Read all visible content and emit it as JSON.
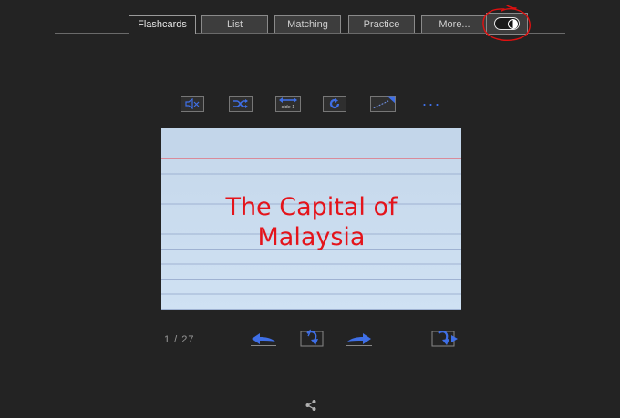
{
  "tabs": [
    {
      "label": "Flashcards",
      "active": true
    },
    {
      "label": "List",
      "active": false
    },
    {
      "label": "Matching",
      "active": false
    },
    {
      "label": "Practice",
      "active": false
    },
    {
      "label": "More...",
      "active": false
    }
  ],
  "theme_toggle": {
    "icon": "contrast-toggle-icon",
    "annotated": true,
    "annotation_color": "#e01010"
  },
  "toolbar": {
    "buttons": [
      {
        "name": "mute-button",
        "icon": "speaker-muted-icon"
      },
      {
        "name": "shuffle-button",
        "icon": "shuffle-icon"
      },
      {
        "name": "side-switch-button",
        "icon": "swap-side-icon",
        "label": "side 1"
      },
      {
        "name": "restart-button",
        "icon": "refresh-icon"
      },
      {
        "name": "autoplay-button",
        "icon": "progress-arrow-icon"
      },
      {
        "name": "more-options-button",
        "icon": "ellipsis-icon"
      }
    ]
  },
  "card": {
    "text_line1": "The Capital of",
    "text_line2": "Malaysia"
  },
  "navigation": {
    "counter": "1 / 27",
    "prev_icon": "arrow-left-icon",
    "flip_icon": "flip-card-icon",
    "next_icon": "arrow-right-icon",
    "flip_next_icon": "flip-next-icon"
  },
  "share": {
    "icon": "share-icon"
  },
  "colors": {
    "accent": "#3f6fe6",
    "card_text": "#e4141b",
    "background": "#232323"
  }
}
